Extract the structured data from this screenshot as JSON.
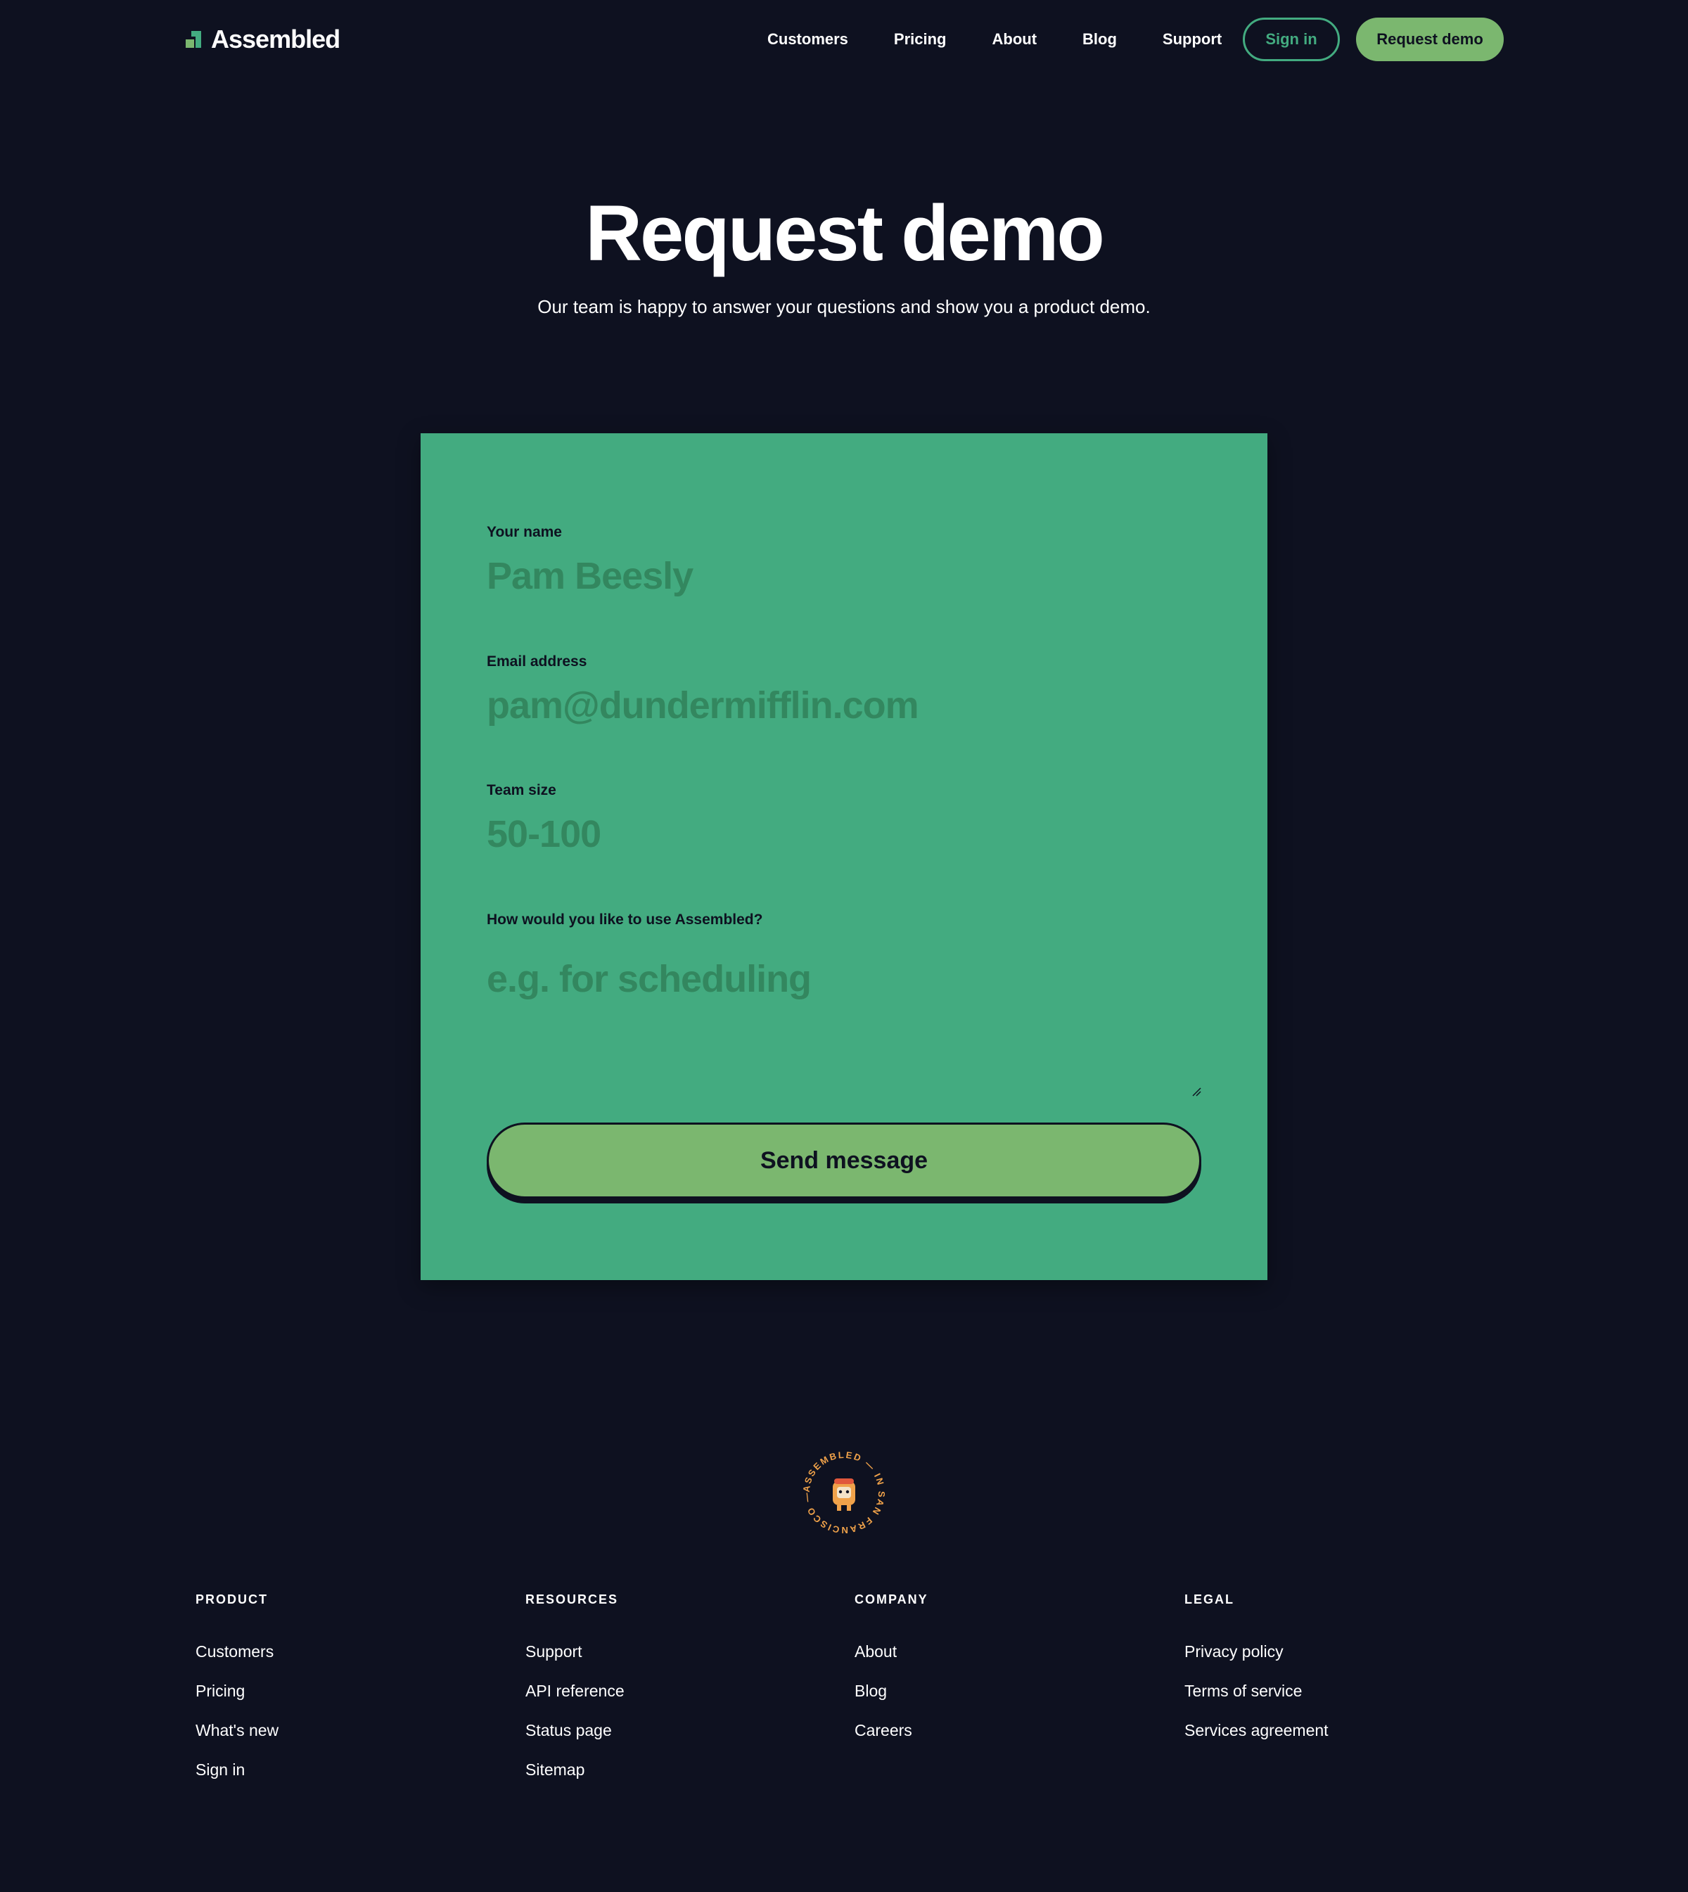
{
  "header": {
    "logo_text": "Assembled",
    "nav": [
      "Customers",
      "Pricing",
      "About",
      "Blog",
      "Support"
    ],
    "sign_in": "Sign in",
    "request_demo": "Request demo"
  },
  "hero": {
    "title": "Request demo",
    "subtitle": "Our team is happy to answer your questions and show you a product demo."
  },
  "form": {
    "name": {
      "label": "Your name",
      "placeholder": "Pam Beesly",
      "value": ""
    },
    "email": {
      "label": "Email address",
      "placeholder": "pam@dundermifflin.com",
      "value": ""
    },
    "team_size": {
      "label": "Team size",
      "placeholder": "50-100",
      "value": ""
    },
    "use": {
      "label": "How would you like to use Assembled?",
      "placeholder": "e.g. for scheduling",
      "value": ""
    },
    "submit": "Send message"
  },
  "badge": {
    "ring_text": "ASSEMBLED — IN SAN FRANCISCO —"
  },
  "footer": {
    "columns": [
      {
        "title": "PRODUCT",
        "links": [
          "Customers",
          "Pricing",
          "What's new",
          "Sign in"
        ]
      },
      {
        "title": "RESOURCES",
        "links": [
          "Support",
          "API reference",
          "Status page",
          "Sitemap"
        ]
      },
      {
        "title": "COMPANY",
        "links": [
          "About",
          "Blog",
          "Careers"
        ]
      },
      {
        "title": "LEGAL",
        "links": [
          "Privacy policy",
          "Terms of service",
          "Services agreement"
        ]
      }
    ]
  },
  "colors": {
    "background": "#0e1120",
    "brand_green": "#43ab80",
    "button_green": "#7bb76f",
    "badge_orange": "#f0a24a"
  },
  "icons": {
    "logo": "assembled-logo-icon",
    "badge": "sf-badge-icon",
    "resize": "resize-grip-icon"
  }
}
